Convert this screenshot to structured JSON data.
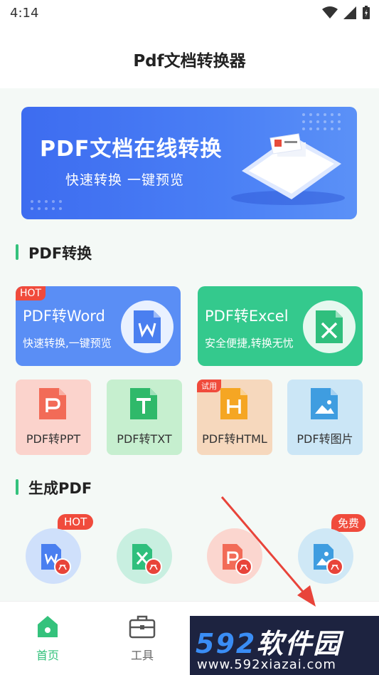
{
  "status": {
    "time": "4:14"
  },
  "app": {
    "title": "Pdf文档转换器"
  },
  "banner": {
    "title": "PDF文档在线转换",
    "subtitle": "快速转换  一键预览"
  },
  "sections": {
    "convert": "PDF转换",
    "generate": "生成PDF"
  },
  "big_cards": [
    {
      "title": "PDF转Word",
      "subtitle": "快速转换,一键预览",
      "tag": "HOT",
      "icon": "word-icon",
      "color": "#5a8ef5"
    },
    {
      "title": "PDF转Excel",
      "subtitle": "安全便捷,转换无忧",
      "icon": "excel-icon",
      "color": "#34c98d"
    }
  ],
  "small_cards": [
    {
      "label": "PDF转PPT",
      "icon": "ppt-icon",
      "color": "#f26b57"
    },
    {
      "label": "PDF转TXT",
      "icon": "txt-icon",
      "color": "#2fb96a"
    },
    {
      "label": "PDF转HTML",
      "icon": "html-icon",
      "color": "#f5a623",
      "tag": "试用"
    },
    {
      "label": "PDF转图片",
      "icon": "image-icon",
      "color": "#3f9de0"
    }
  ],
  "generate_tags": {
    "word": "HOT",
    "image": "免费"
  },
  "nav": {
    "home": "首页",
    "tools": "工具"
  },
  "watermark": {
    "brand_num": "592",
    "brand_text": "软件园",
    "url": "www.592xiazai.com"
  },
  "colors": {
    "accent": "#34c27c",
    "hot": "#f04b3c",
    "banner": "#4a7ff5"
  }
}
